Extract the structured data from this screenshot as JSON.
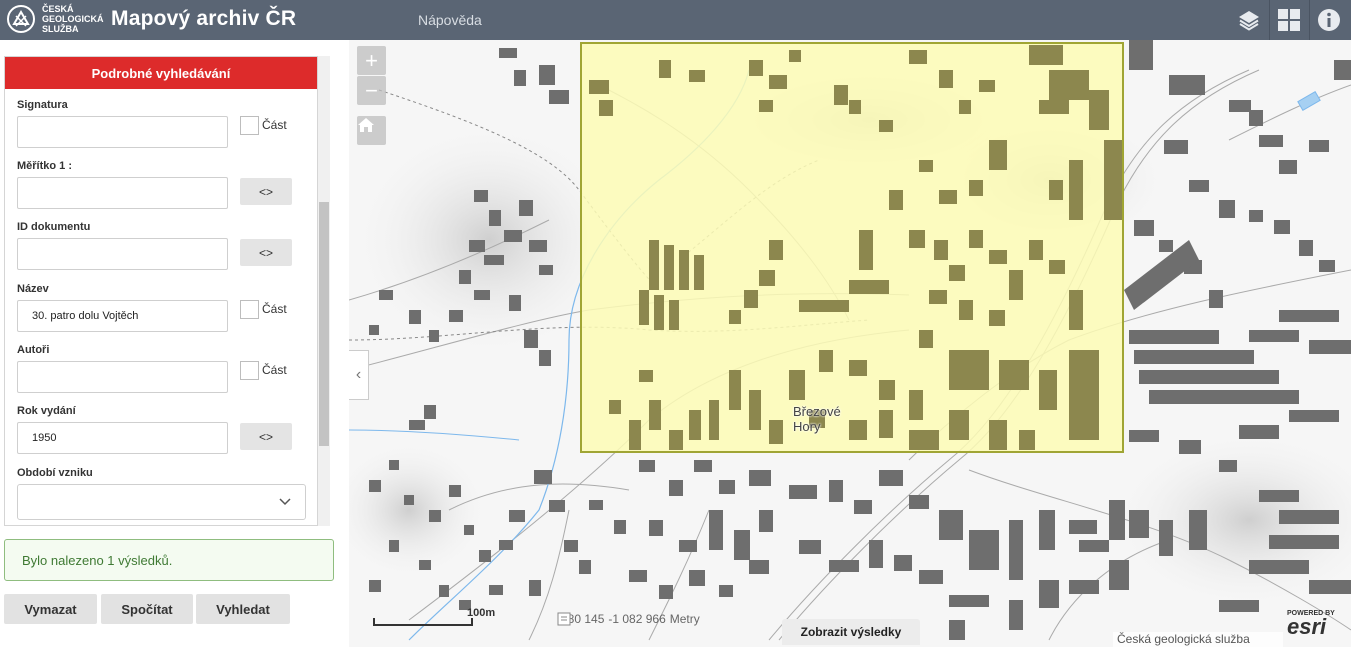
{
  "header": {
    "org_line1": "ČESKÁ",
    "org_line2": "GEOLOGICKÁ",
    "org_line3": "SLUŽBA",
    "title": "Mapový archiv ČR",
    "help": "Nápověda",
    "icons": [
      "layers-icon",
      "grid-icon",
      "info-icon"
    ],
    "bg_color": "#5a6574"
  },
  "search": {
    "header": "Podrobné vyhledávání",
    "accent_color": "#dd2b2b",
    "fields": {
      "signatura": {
        "label": "Signatura",
        "value": "",
        "part_label": "Část"
      },
      "meritko": {
        "label": "Měřítko 1 :",
        "value": "",
        "range_label": "<>"
      },
      "id_dokumentu": {
        "label": "ID dokumentu",
        "value": "",
        "range_label": "<>"
      },
      "nazev": {
        "label": "Název",
        "value": "30. patro dolu Vojtěch",
        "part_label": "Část"
      },
      "autori": {
        "label": "Autoři",
        "value": "",
        "part_label": "Část"
      },
      "rok_vydani": {
        "label": "Rok vydání",
        "value": "1950",
        "range_label": "<>"
      },
      "obdobi_vzniku": {
        "label": "Období vzniku",
        "value": ""
      }
    },
    "result_message": "Bylo nalezeno 1 výsledků.",
    "buttons": {
      "clear": "Vymazat",
      "count": "Spočítat",
      "search": "Vyhledat"
    }
  },
  "map": {
    "zoom_in": "+",
    "zoom_out": "−",
    "place_label_line1": "Březové",
    "place_label_line2": "Hory",
    "scale_label": "100m",
    "coord_x": "-780 145",
    "coord_y": "-1 082 966",
    "coord_unit": "Metry",
    "show_results": "Zobrazit výsledky",
    "attribution": "Česká geologická služba",
    "esri_powered": "POWERED BY",
    "esri_name": "esri",
    "highlight_color": "#fdfbb5",
    "highlight_border": "#a0a534"
  }
}
